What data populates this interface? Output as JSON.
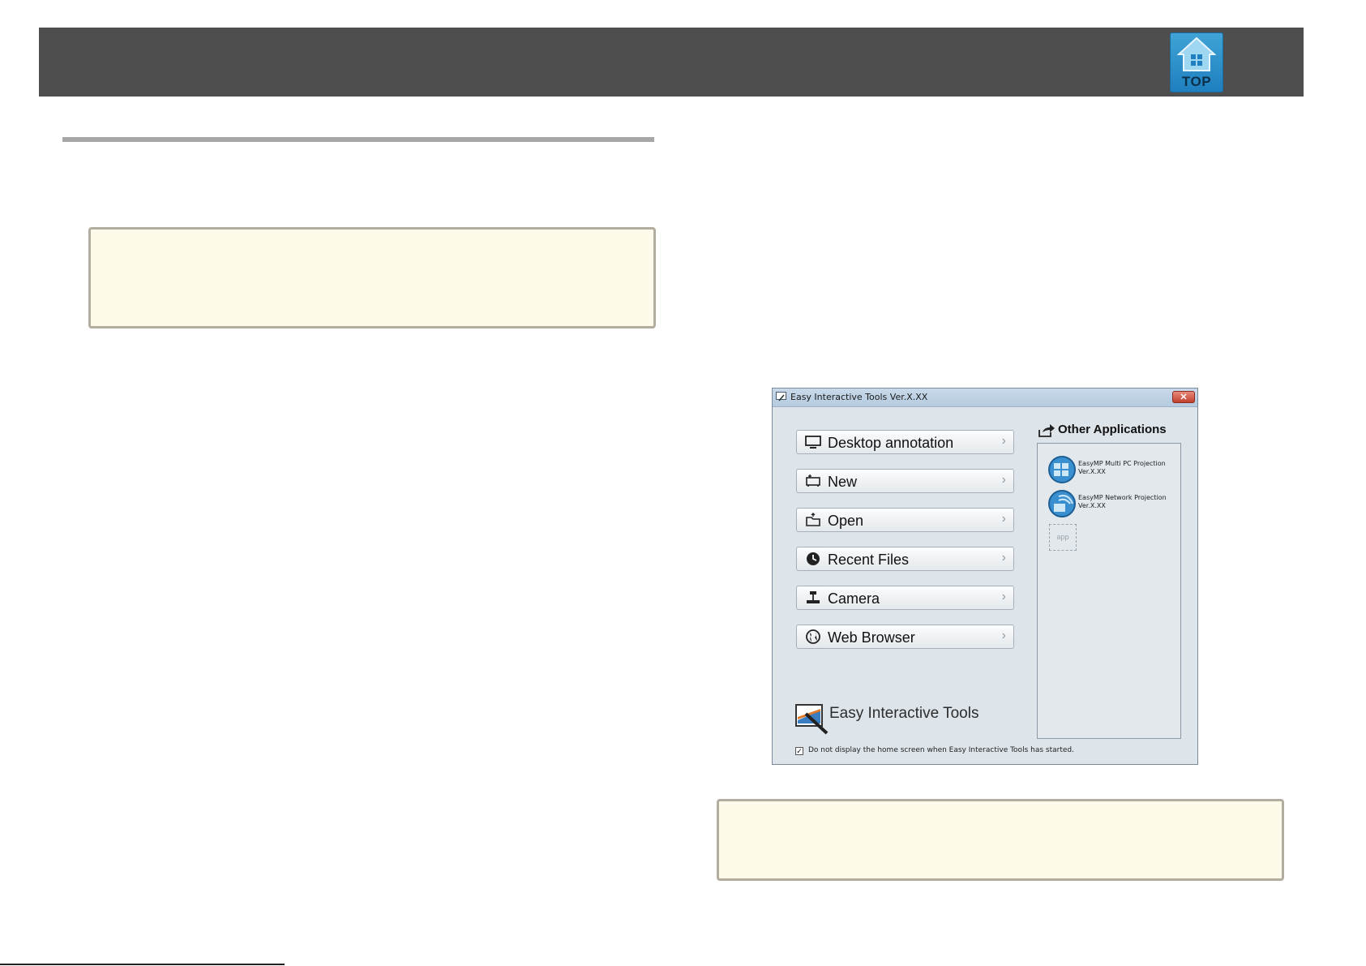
{
  "header": {
    "top_button_label": "TOP"
  },
  "window": {
    "title": "Easy Interactive Tools Ver.X.XX",
    "close_label": "✕",
    "menu": [
      {
        "label": "Desktop annotation",
        "icon": "monitor-icon"
      },
      {
        "label": "New",
        "icon": "new-board-icon"
      },
      {
        "label": "Open",
        "icon": "folder-open-icon"
      },
      {
        "label": "Recent Files",
        "icon": "clock-icon"
      },
      {
        "label": "Camera",
        "icon": "camera-icon"
      },
      {
        "label": "Web Browser",
        "icon": "globe-icon"
      }
    ],
    "other_apps": {
      "heading": "Other Applications",
      "items": [
        {
          "name": "EasyMP Multi PC Projection",
          "version": "Ver.X.XX"
        },
        {
          "name": "EasyMP Network Projection",
          "version": "Ver.X.XX"
        }
      ],
      "placeholder": "app"
    },
    "brand": "Easy Interactive Tools",
    "checkbox_label": "Do not display the home screen when Easy Interactive Tools has started.",
    "checkbox_checked": true
  },
  "colors": {
    "header_bar": "#4e4e4e",
    "note_background": "#fefaea",
    "note_border": "#b3ada0",
    "window_background": "#dde4ea"
  }
}
